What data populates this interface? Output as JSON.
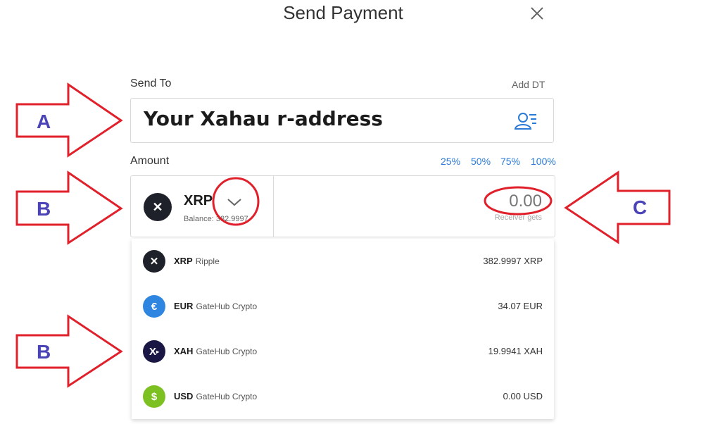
{
  "dialog": {
    "title": "Send Payment"
  },
  "send_to": {
    "label": "Send To",
    "add_dt": "Add DT",
    "value": "Your Xahau r-address"
  },
  "amount": {
    "label": "Amount",
    "percent_options": [
      "25%",
      "50%",
      "75%",
      "100%"
    ],
    "selected_currency": "XRP",
    "balance_text": "Balance: 382.9997",
    "value": "0.00",
    "sub_label": "Receiver gets"
  },
  "currency_list": [
    {
      "code": "XRP",
      "issuer": "Ripple",
      "balance": "382.9997 XRP",
      "icon": "xrp-icon",
      "color": "#1e2129",
      "glyph": "✕"
    },
    {
      "code": "EUR",
      "issuer": "GateHub Crypto",
      "balance": "34.07 EUR",
      "icon": "euro-icon",
      "color": "#2f86e0",
      "glyph": "€"
    },
    {
      "code": "XAH",
      "issuer": "GateHub Crypto",
      "balance": "19.9941 XAH",
      "icon": "xah-icon",
      "color": "#1a1744",
      "glyph": "X"
    },
    {
      "code": "USD",
      "issuer": "GateHub Crypto",
      "balance": "0.00 USD",
      "icon": "dollar-icon",
      "color": "#7cc021",
      "glyph": "$"
    }
  ],
  "annotations": {
    "labels": [
      "A",
      "B",
      "C",
      "B"
    ],
    "color": "#e0212b",
    "letter_color": "#4b44b8"
  }
}
